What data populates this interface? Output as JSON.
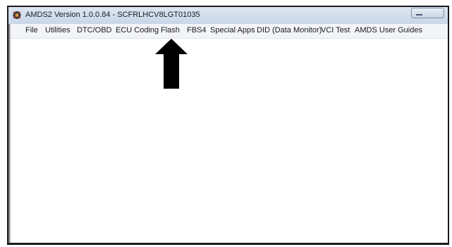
{
  "window": {
    "title": "AMDS2 Version 1.0.0.84 - SCFRLHCV8LGT01035",
    "icon": "app-gear-icon"
  },
  "menu": {
    "items": [
      {
        "label": "File"
      },
      {
        "label": "Utilities"
      },
      {
        "label": "DTC/OBD"
      },
      {
        "label": "ECU Coding"
      },
      {
        "label": "Flash"
      },
      {
        "label": "FBS4"
      },
      {
        "label": "Special Apps"
      },
      {
        "label": "DID (Data Monitor)"
      },
      {
        "label": "VCI Test"
      },
      {
        "label": "AMDS User Guides"
      }
    ]
  },
  "annotation": {
    "arrow_icon": "up-arrow-icon",
    "arrow_color": "#000000"
  }
}
